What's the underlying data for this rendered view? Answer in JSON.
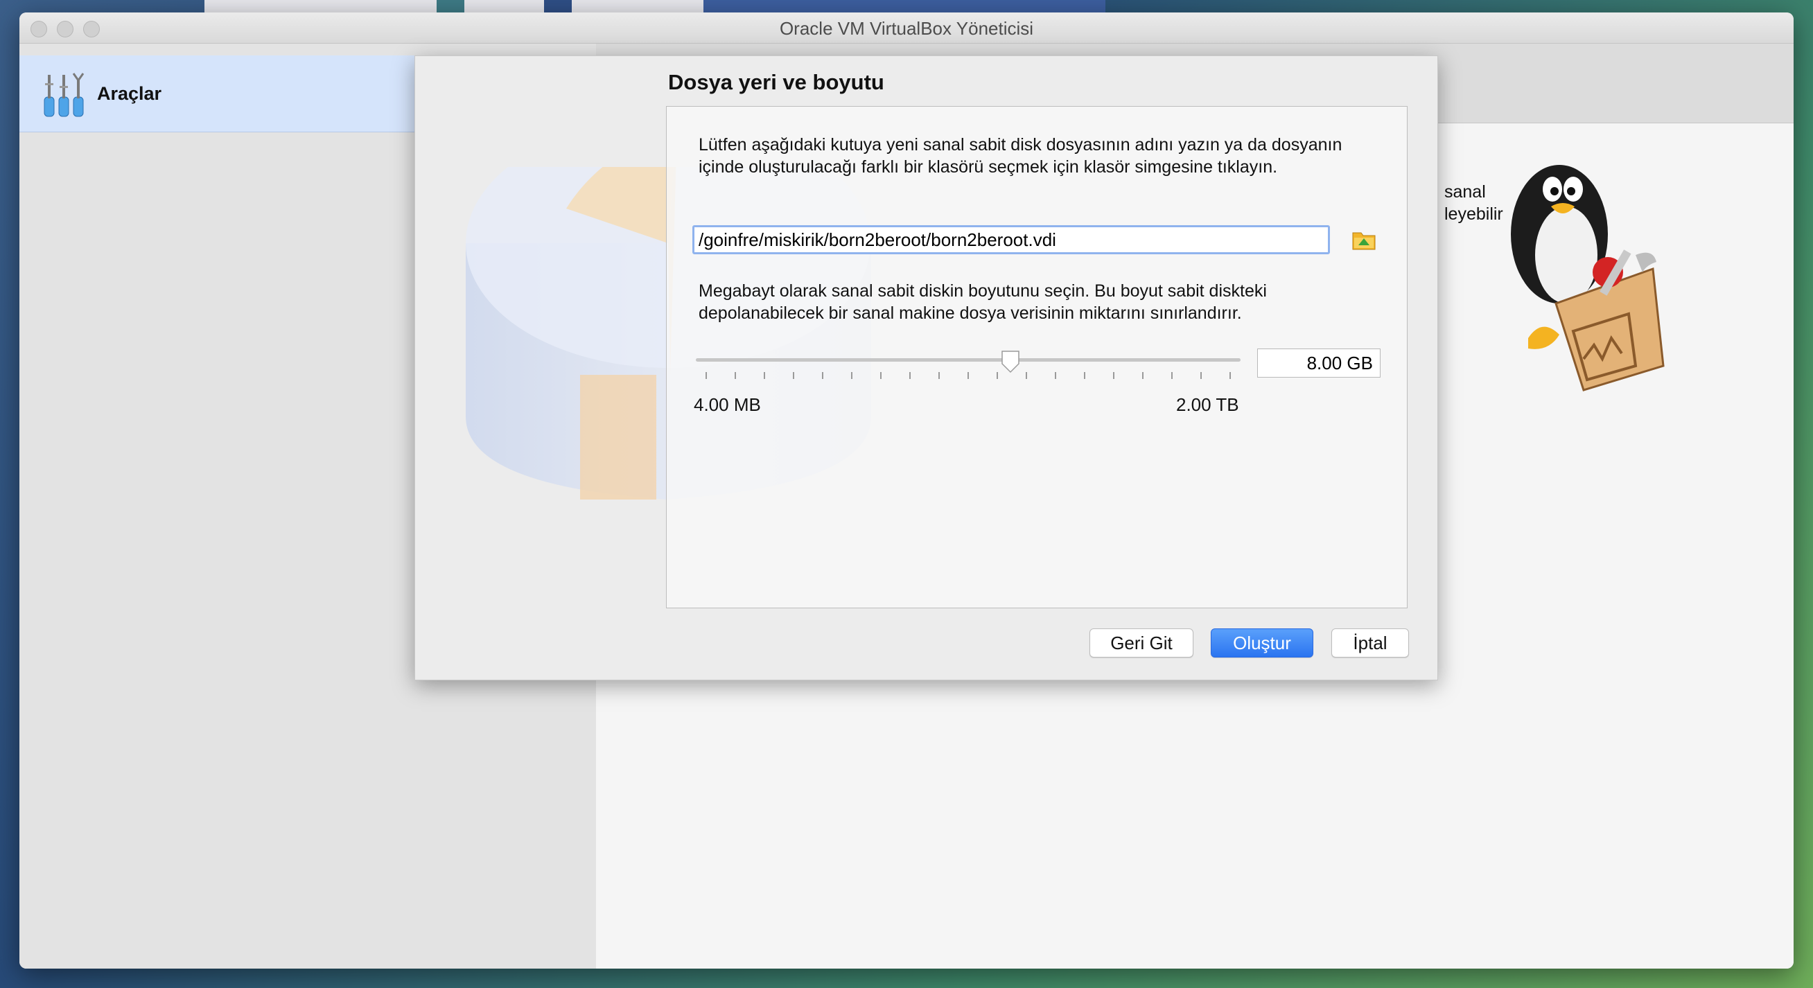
{
  "window": {
    "title": "Oracle VM VirtualBox Yöneticisi"
  },
  "sidebar": {
    "items": [
      {
        "label": "Araçlar",
        "icon": "tools-icon"
      }
    ]
  },
  "welcome_fragments": {
    "line1": "sanal",
    "line2": "leyebilir"
  },
  "dialog": {
    "title": "Dosya yeri ve boyutu",
    "location_description": "Lütfen aşağıdaki kutuya yeni sanal sabit disk dosyasının adını yazın ya da dosyanın içinde oluşturulacağı farklı bir klasörü seçmek için klasör simgesine tıklayın.",
    "file_path": "/goinfre/miskirik/born2beroot/born2beroot.vdi",
    "size_description": "Megabayt olarak sanal sabit diskin boyutunu seçin. Bu boyut sabit diskteki depolanabilecek bir sanal makine dosya verisinin miktarını sınırlandırır.",
    "size_value": "8.00 GB",
    "slider_min_label": "4.00 MB",
    "slider_max_label": "2.00 TB",
    "slider_position_fraction": 0.578,
    "buttons": {
      "back": "Geri Git",
      "create": "Oluştur",
      "cancel": "İptal"
    }
  },
  "colors": {
    "accent": "#2b74f0",
    "selection": "#d5e4fb"
  }
}
